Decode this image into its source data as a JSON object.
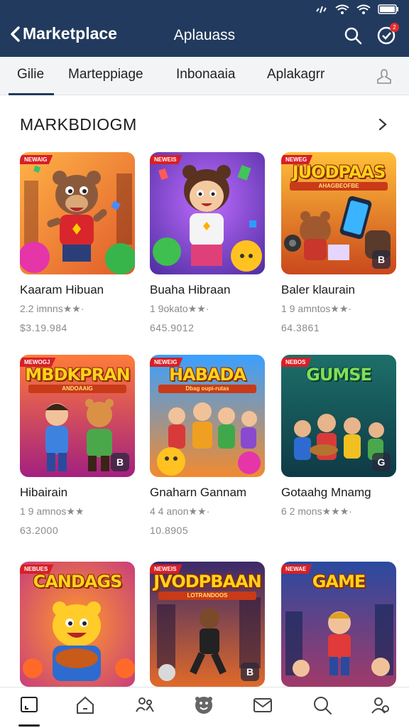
{
  "header": {
    "back_label": "Marketplace",
    "title": "Aplauass",
    "notification_count": "2",
    "background_color": "#223a5e"
  },
  "tabs": [
    {
      "label": "Gilie",
      "active": true
    },
    {
      "label": "Marteppiage",
      "active": false
    },
    {
      "label": "Inbonaaia",
      "active": false
    },
    {
      "label": "Aplakagrr",
      "active": false
    }
  ],
  "section": {
    "title": "MARKBDIOGM"
  },
  "cards": [
    {
      "name": "Kaaram Hibuan",
      "rating": "2.2 imnns★★·",
      "price": "$3.19.984",
      "tag": "NEWAIG",
      "overlay_title": "",
      "overlay_sub": "",
      "corner": ""
    },
    {
      "name": "Buaha Hibraan",
      "rating": "1 9okato★★·",
      "price": "645.9012",
      "tag": "NEWEIS",
      "overlay_title": "",
      "overlay_sub": "",
      "corner": ""
    },
    {
      "name": "Baler klaurain",
      "rating": "1 9 amntos★★·",
      "price": "64.3861",
      "tag": "NEWEG",
      "overlay_title": "JUODPAAS",
      "overlay_sub": "AHAGBEOFBE",
      "corner": "B"
    },
    {
      "name": "Hibairain",
      "rating": "1 9 amnos★★",
      "price": "63.2000",
      "tag": "MEWOGJ",
      "overlay_title": "MBDKPRAN",
      "overlay_sub": "ANDOAAIG",
      "corner": "B"
    },
    {
      "name": "Gnaharn Gannam",
      "rating": "4 4 anon★★·",
      "price": "10.8905",
      "tag": "NEWEIG",
      "overlay_title": "HABADA",
      "overlay_sub": "Dbag oupi-rutas",
      "corner": ""
    },
    {
      "name": "Gotaahg Mnamg",
      "rating": "6 2 mons★★★·",
      "price": "",
      "tag": "NEBOS",
      "overlay_title": "GUMSE",
      "overlay_sub": "",
      "corner": "G"
    },
    {
      "name": "",
      "rating": "",
      "price": "",
      "tag": "NEBUES",
      "overlay_title": "CANDAGS",
      "overlay_sub": "",
      "corner": ""
    },
    {
      "name": "",
      "rating": "",
      "price": "",
      "tag": "NEWEIS",
      "overlay_title": "JVODPBAAN",
      "overlay_sub": "LOTRANDOOS",
      "corner": "B"
    },
    {
      "name": "",
      "rating": "",
      "price": "",
      "tag": "NEWAE",
      "overlay_title": "GAME",
      "overlay_sub": "",
      "corner": ""
    }
  ],
  "bottom_nav": [
    "library-icon",
    "home-icon",
    "people-icon",
    "emoji-icon",
    "mail-icon",
    "search-icon",
    "account-icon"
  ]
}
